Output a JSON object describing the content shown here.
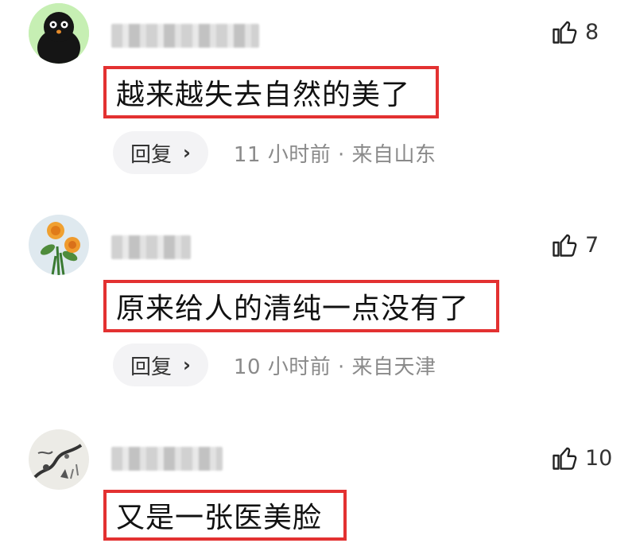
{
  "comments": [
    {
      "text": "越来越失去自然的美了",
      "likes": "8",
      "reply_label": "回复",
      "meta": "11 小时前 · 来自山东",
      "avatar": "penguin-avatar"
    },
    {
      "text": "原来给人的清纯一点没有了",
      "likes": "7",
      "reply_label": "回复",
      "meta": "10 小时前 · 来自天津",
      "avatar": "flower-avatar"
    },
    {
      "text": "又是一张医美脸",
      "likes": "10",
      "reply_label": "",
      "meta": "",
      "avatar": "ink-painting-avatar"
    }
  ],
  "icons": {
    "like": "thumbs-up-icon",
    "reply_chevron": "chevron-right-icon"
  },
  "colors": {
    "highlight_border": "#e33131",
    "reply_bg": "#f3f3f5",
    "meta_text": "#8a8a8a"
  }
}
